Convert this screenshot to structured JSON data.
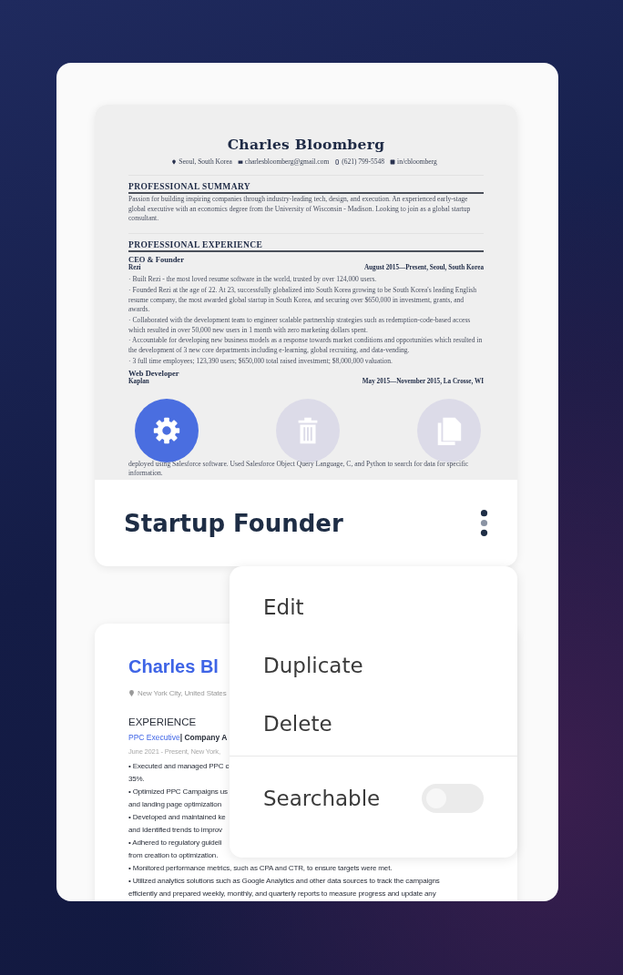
{
  "resume_card": {
    "preview": {
      "name": "Charles Bloomberg",
      "contacts": [
        {
          "kind": "location",
          "text": "Seoul, South Korea"
        },
        {
          "kind": "email",
          "text": "charlesbloomberg@gmail.com"
        },
        {
          "kind": "phone",
          "text": "(621) 799-5548"
        },
        {
          "kind": "linkedin",
          "text": "in/cbloomberg"
        }
      ],
      "summary": {
        "heading": "PROFESSIONAL SUMMARY",
        "text": "Passion for building inspiring companies through industry-leading tech, design, and execution. An experienced early-stage global executive with an economics degree from the University of Wisconsin - Madison. Looking to join as a global startup consultant."
      },
      "experience": {
        "heading": "PROFESSIONAL EXPERIENCE",
        "jobs": [
          {
            "title": "CEO & Founder",
            "company": "Rezi",
            "dates": "August 2015—Present, Seoul, South Korea",
            "bullets": [
              "· Built Rezi - the most loved resume software in the world, trusted by over 124,000 users.",
              "· Founded Rezi at the age of 22. At 23, successfully globalized into South Korea growing to be South Korea's leading English resume company, the most awarded global startup in South Korea, and securing over $650,000 in investment, grants, and awards.",
              "· Collaborated with the development team to engineer scalable partnership strategies such as redemption-code-based access which resulted in over 50,000 new users in 1 month with zero marketing dollars spent.",
              "· Accountable for developing new business models as a response towards market conditions and opportunities which resulted in the development of 3 new core departments including e-learning, global recruiting, and data-vending.",
              "· 3 full time employees; 123,390 users; $650,000 total raised investment; $8,000,000 valuation."
            ]
          },
          {
            "title": "Web Developer",
            "company": "Kaplan",
            "dates": "May 2015—November 2015, La Crosse, WI"
          }
        ]
      },
      "trailing_text": "deployed using Salesforce software. Used Salesforce Object Query Language, C, and Python to search for data for specific information."
    },
    "actions": [
      {
        "kind": "settings",
        "selected": true
      },
      {
        "kind": "delete",
        "selected": false
      },
      {
        "kind": "duplicate",
        "selected": false
      }
    ],
    "title": "Startup Founder"
  },
  "context_menu": {
    "items": [
      {
        "label": "Edit"
      },
      {
        "label": "Duplicate"
      },
      {
        "label": "Delete"
      }
    ],
    "toggle": {
      "label": "Searchable",
      "on": false
    }
  },
  "second_card": {
    "name": "Charles Bl",
    "location": "New York City, United States",
    "section": "EXPERIENCE",
    "job_title": "PPC Executive",
    "company": "| Company A",
    "dates": "June 2021 - Present, New York,",
    "lines": [
      "• Executed and managed PPC c",
      "35%.",
      "• Optimized PPC Campaigns us",
      "and landing page optimization",
      "• Developed and maintained ke",
      "and Identified trends to improv",
      "• Adhered to regulatory guideli",
      "from creation to optimization.",
      "• Monitored performance metrics, such as CPA and CTR, to ensure targets were met.",
      "• Utilized analytics solutions such as Google Analytics and other data sources to track the campaigns",
      "efficiently and prepared weekly, monthly, and quarterly reports to measure progress and update any"
    ]
  }
}
